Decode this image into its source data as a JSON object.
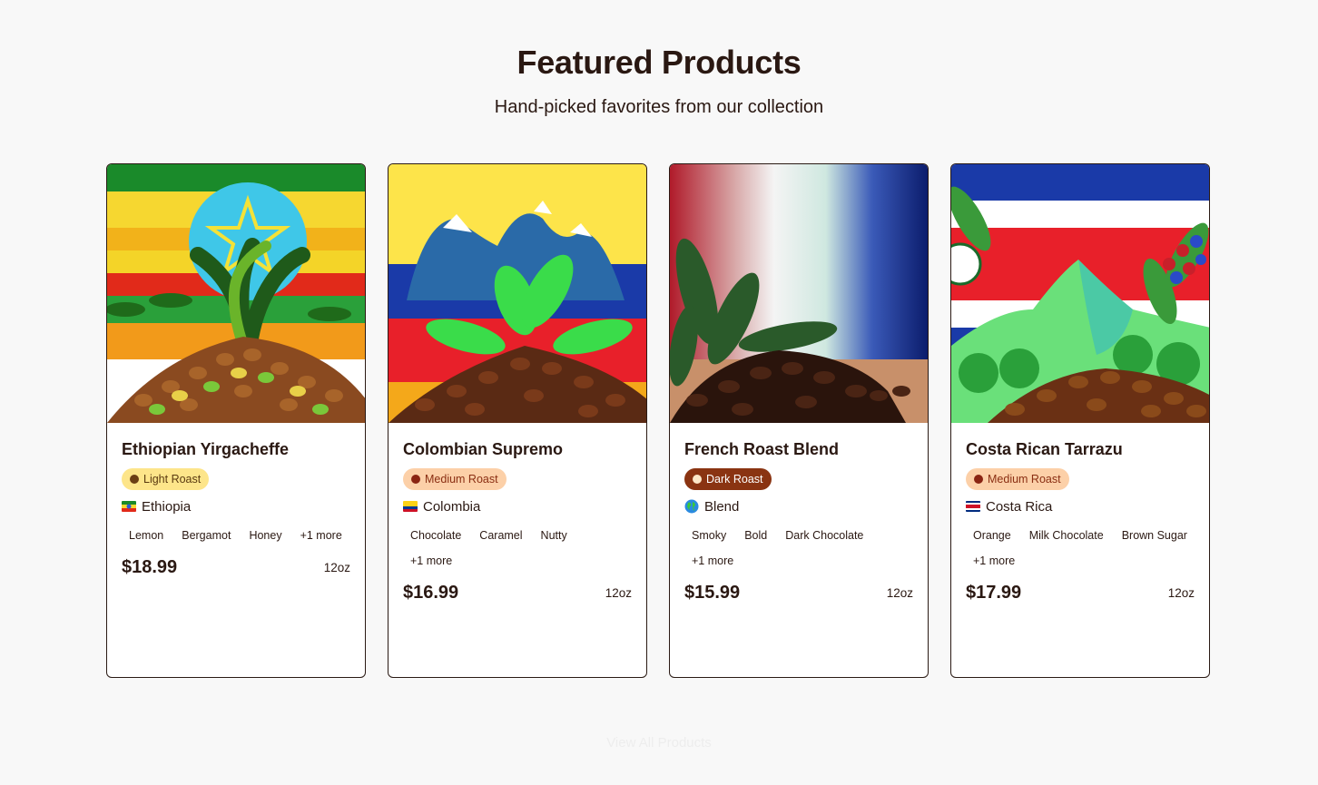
{
  "section": {
    "title": "Featured Products",
    "subtitle": "Hand-picked favorites from our collection",
    "view_all_label": "View All Products"
  },
  "products": [
    {
      "name": "Ethiopian Yirgacheffe",
      "roast": "Light Roast",
      "origin": "Ethiopia",
      "notes": [
        "Lemon",
        "Bergamot",
        "Honey",
        "+1 more"
      ],
      "price": "$18.99",
      "size": "12oz"
    },
    {
      "name": "Colombian Supremo",
      "roast": "Medium Roast",
      "origin": "Colombia",
      "notes": [
        "Chocolate",
        "Caramel",
        "Nutty",
        "+1 more"
      ],
      "price": "$16.99",
      "size": "12oz"
    },
    {
      "name": "French Roast Blend",
      "roast": "Dark Roast",
      "origin": "Blend",
      "notes": [
        "Smoky",
        "Bold",
        "Dark Chocolate",
        "+1 more"
      ],
      "price": "$15.99",
      "size": "12oz"
    },
    {
      "name": "Costa Rican Tarrazu",
      "roast": "Medium Roast",
      "origin": "Costa Rica",
      "notes": [
        "Orange",
        "Milk Chocolate",
        "Brown Sugar",
        "+1 more"
      ],
      "price": "$17.99",
      "size": "12oz"
    }
  ],
  "colors": {
    "background": "#f8f8f8",
    "text": "#2a1812",
    "light_roast_badge": "#fde58a",
    "medium_roast_badge": "#fcd0a8",
    "dark_roast_badge": "#8a3412"
  },
  "icons": {
    "roast_indicator": "dot-icon",
    "origin_ethiopia": "ethiopia-flag-icon",
    "origin_colombia": "colombia-flag-icon",
    "origin_blend": "globe-icon",
    "origin_costa_rica": "costa-rica-flag-icon"
  }
}
